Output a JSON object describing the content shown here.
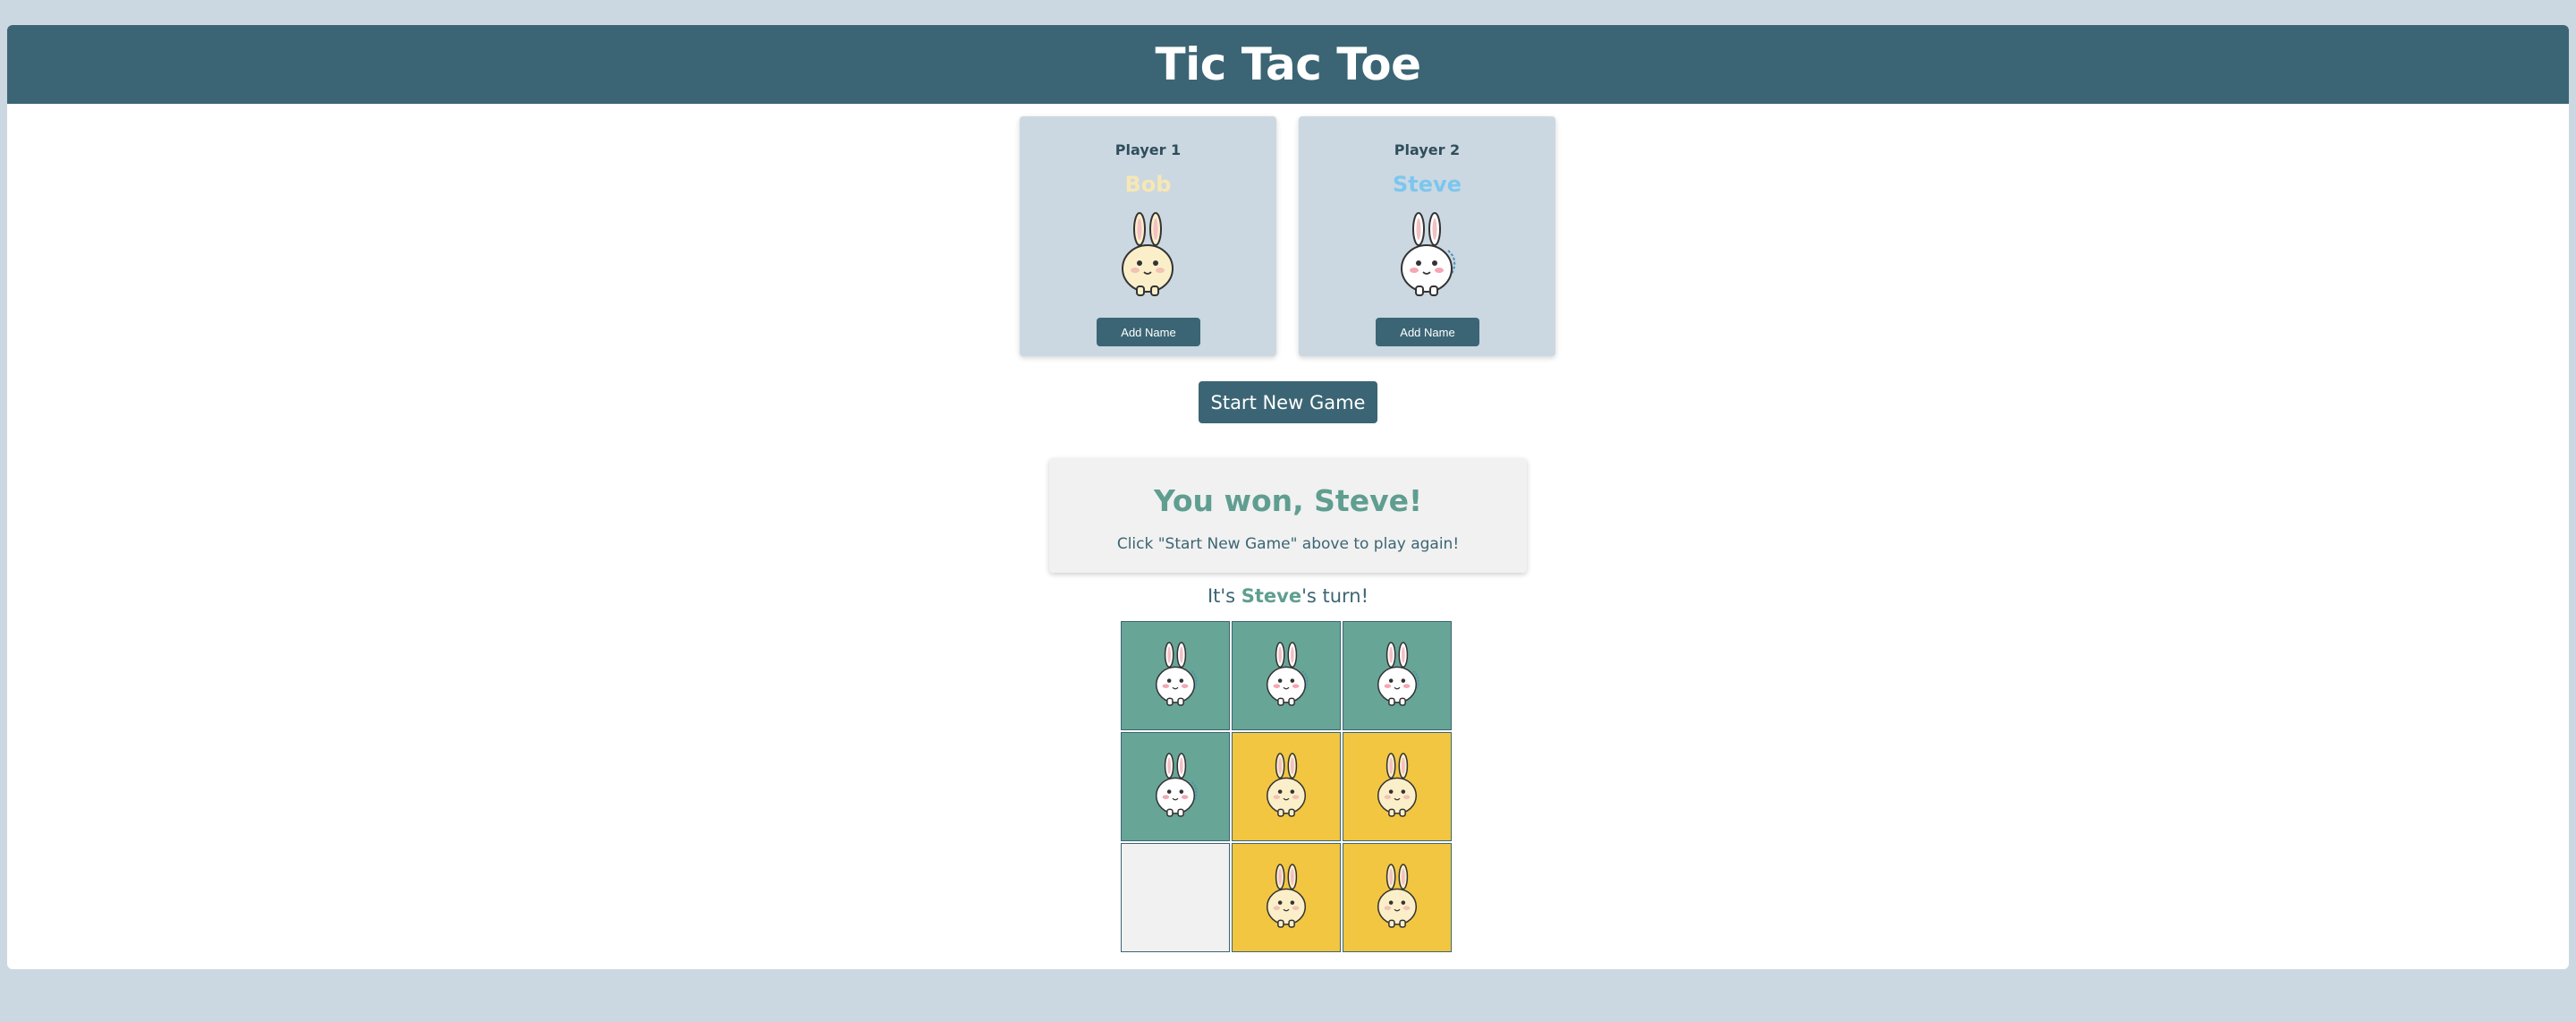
{
  "header": {
    "title": "Tic Tac Toe"
  },
  "players": [
    {
      "label": "Player 1",
      "name": "Bob",
      "name_color": "#f7e7b4",
      "avatar": "cream-bunny-icon",
      "button_label": "Add Name"
    },
    {
      "label": "Player 2",
      "name": "Steve",
      "name_color": "#7cc6ee",
      "avatar": "white-bunny-icon",
      "button_label": "Add Name"
    }
  ],
  "start_button": {
    "label": "Start New Game"
  },
  "result": {
    "title": "You won, Steve!",
    "subtitle": "Click \"Start New Game\" above to play again!"
  },
  "turn": {
    "prefix": "It's ",
    "name": "Steve",
    "suffix": "'s turn!"
  },
  "board": {
    "colors": {
      "player1": "#f2c641",
      "player2": "#67a597",
      "empty": "#f1f1f1"
    },
    "cells": [
      {
        "owner": "player2",
        "icon": "white-bunny-icon"
      },
      {
        "owner": "player2",
        "icon": "white-bunny-icon"
      },
      {
        "owner": "player2",
        "icon": "white-bunny-icon"
      },
      {
        "owner": "player2",
        "icon": "white-bunny-icon"
      },
      {
        "owner": "player1",
        "icon": "cream-bunny-icon"
      },
      {
        "owner": "player1",
        "icon": "cream-bunny-icon"
      },
      {
        "owner": "empty",
        "icon": ""
      },
      {
        "owner": "player1",
        "icon": "cream-bunny-icon"
      },
      {
        "owner": "player1",
        "icon": "cream-bunny-icon"
      }
    ]
  }
}
